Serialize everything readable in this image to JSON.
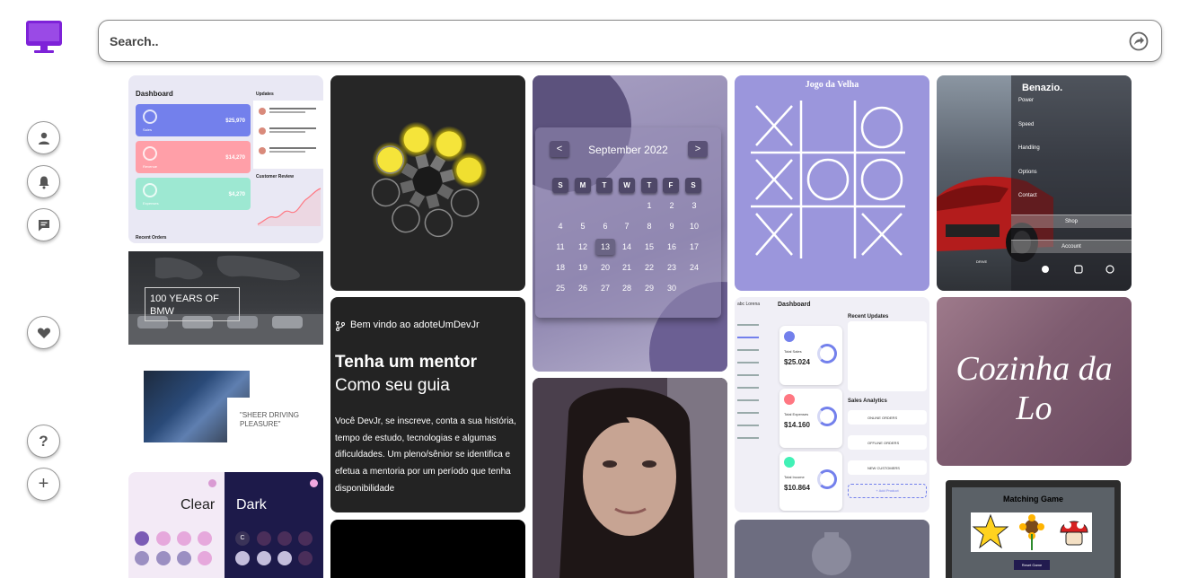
{
  "search": {
    "placeholder": "Search.."
  },
  "sidebar": {
    "buttons": [
      {
        "name": "profile",
        "icon": "user-icon"
      },
      {
        "name": "notifications",
        "icon": "bell-icon"
      },
      {
        "name": "messages",
        "icon": "chat-icon"
      },
      {
        "name": "favorites",
        "icon": "heart-icon"
      },
      {
        "name": "help",
        "icon": "question-icon",
        "label": "?"
      },
      {
        "name": "add",
        "icon": "plus-icon",
        "label": "+"
      }
    ]
  },
  "colors": {
    "brand": "#7e22d8",
    "tic_tac_toe_bg": "#9b96dc",
    "calendar_bg": "#8b82ad"
  },
  "cards": {
    "dashboard": {
      "title": "Dashboard",
      "updates": "Updates",
      "customer_review": "Customer Review",
      "recent_orders": "Recent Orders",
      "tiles": [
        {
          "name": "Sales",
          "value": "$25,970"
        },
        {
          "name": "Revenue",
          "value": "$14,270"
        },
        {
          "name": "Expenses",
          "value": "$4,270"
        }
      ]
    },
    "calendar": {
      "month": "September 2022",
      "prev": "<",
      "next": ">",
      "weekdays": [
        "S",
        "M",
        "T",
        "W",
        "T",
        "F",
        "S"
      ],
      "days": [
        [
          "",
          "",
          "",
          "",
          "1",
          "2",
          "3"
        ],
        [
          "4",
          "5",
          "6",
          "7",
          "8",
          "9",
          "10"
        ],
        [
          "11",
          "12",
          "13",
          "14",
          "15",
          "16",
          "17"
        ],
        [
          "18",
          "19",
          "20",
          "21",
          "22",
          "23",
          "24"
        ],
        [
          "25",
          "26",
          "27",
          "28",
          "29",
          "30",
          ""
        ]
      ],
      "selected": "13"
    },
    "tic_tac_toe": {
      "title": "Jogo da Velha",
      "board": [
        [
          "X",
          "",
          "O"
        ],
        [
          "X",
          "O",
          "O"
        ],
        [
          "X",
          "",
          "X"
        ]
      ]
    },
    "car": {
      "brand": "Benazio.",
      "menu": [
        "Power",
        "Speed",
        "Handling",
        "Options",
        "Contact"
      ],
      "shop": "Shop",
      "account": "Account",
      "drive": "DRIVE"
    },
    "bmw": {
      "line1": "100 YEARS OF",
      "line2": "BMW"
    },
    "sheer": {
      "line1": "\"SHEER DRIVING",
      "line2": "PLEASURE\""
    },
    "mentor": {
      "welcome": "Bem vindo ao adoteUmDevJr",
      "heading1": "Tenha um mentor",
      "heading2": "Como seu guia",
      "body": "Você DevJr, se inscreve, conta a sua história, tempo de estudo, tecnologias e algumas dificuldades. Um pleno/sênior se identifica e efetua a mentoria por um período que tenha disponibilidade"
    },
    "calculator": {
      "light": "Clear",
      "dark": "Dark",
      "dark_key": "C"
    },
    "dashboard2": {
      "logo": "abc Lorena",
      "title": "Dashboard",
      "recent_updates": "Recent Updates",
      "sales_analytics": "Sales Analytics",
      "tiles": [
        {
          "name": "Total Sales",
          "value": "$25.024"
        },
        {
          "name": "Total Expenses",
          "value": "$14.160"
        },
        {
          "name": "Total Income",
          "value": "$10.864"
        }
      ],
      "analytics": [
        "ONLINE ORDERS",
        "OFFLINE ORDERS",
        "NEW CUSTOMERS"
      ],
      "add_product": "+ Add Product"
    },
    "cozinha": {
      "title": "Cozinha da Lo"
    },
    "matching": {
      "title": "Matching Game",
      "button": "Reset Game"
    }
  }
}
